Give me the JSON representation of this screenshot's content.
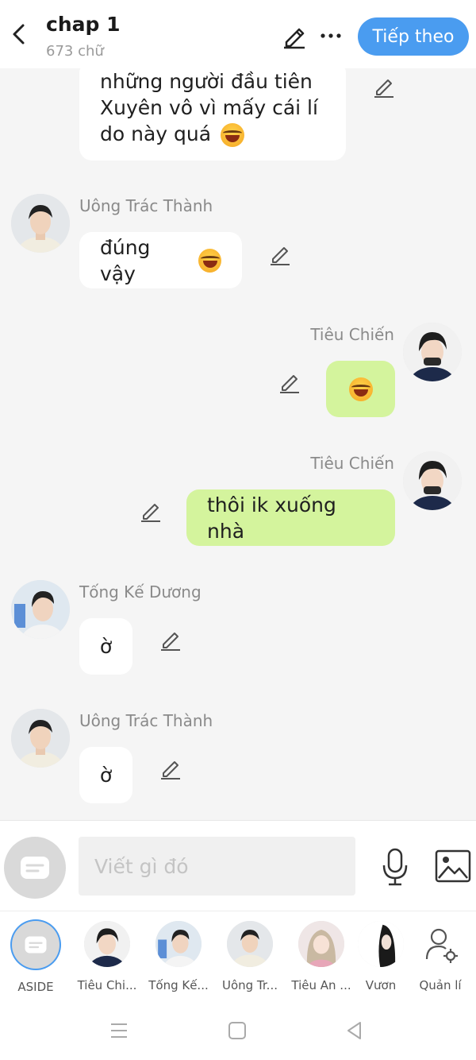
{
  "header": {
    "title": "chap 1",
    "word_count": "673 chữ",
    "next_label": "Tiếp theo"
  },
  "messages": [
    {
      "side": "left",
      "text_lines": [
        "những người đầu tiên",
        "Xuyên vô vì mấy cái lí",
        "do này quá"
      ],
      "emoji": "laugh"
    },
    {
      "side": "left",
      "name": "Uông Trác Thành",
      "text": "đúng vậy",
      "emoji": "laugh"
    },
    {
      "side": "right",
      "name": "Tiêu Chiến",
      "text": "",
      "emoji": "laugh"
    },
    {
      "side": "right",
      "name": "Tiêu Chiến",
      "text": "thôi ik xuống nhà"
    },
    {
      "side": "left",
      "name": "Tống Kế Dương",
      "text": "ờ"
    },
    {
      "side": "left",
      "name": "Uông Trác Thành",
      "text": "ờ"
    }
  ],
  "input": {
    "placeholder": "Viết gì đó"
  },
  "characters": [
    {
      "label": "ASIDE"
    },
    {
      "label": "Tiêu Chi..."
    },
    {
      "label": "Tống Kế..."
    },
    {
      "label": "Uông Tr..."
    },
    {
      "label": "Tiêu An ..."
    },
    {
      "label": "Vươn"
    },
    {
      "label": "Quản lí"
    }
  ],
  "colors": {
    "accent": "#4a9cf0",
    "my_bubble": "#d4f49d",
    "other_bubble": "#ffffff",
    "background": "#f5f5f5"
  },
  "icons": [
    "back-arrow-icon",
    "pencil-icon",
    "more-icon",
    "aside-icon",
    "microphone-icon",
    "image-icon",
    "manage-user-icon",
    "menu-icon",
    "home-icon",
    "back-icon"
  ]
}
